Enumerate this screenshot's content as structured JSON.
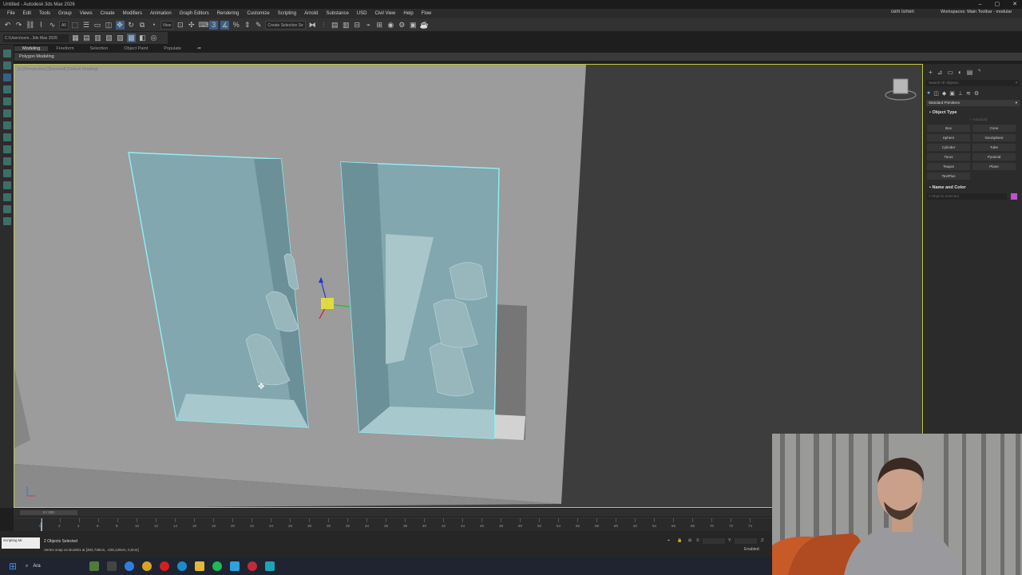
{
  "window": {
    "title": "Untitled - Autodesk 3ds Max 2026",
    "minimize": "–",
    "restore": "▢",
    "close": "✕"
  },
  "menu": {
    "items": [
      "File",
      "Edit",
      "Tools",
      "Group",
      "Views",
      "Create",
      "Modifiers",
      "Animation",
      "Graph Editors",
      "Rendering",
      "Customize",
      "Scripting",
      "Arnold",
      "Substance",
      "USD",
      "Civil View",
      "Help",
      "Flow"
    ],
    "user": "cem ismen",
    "workspace_label": "Workspaces:",
    "workspace_value": "Main Toolbar - modular"
  },
  "toolbar": {
    "filter": "All",
    "view_dropdown": "View",
    "selection_set": "Create Selection Se"
  },
  "toolbar2": {
    "path": "C:\\Users\\cem...3ds Max 2026"
  },
  "ribbon": {
    "tabs": [
      "Modeling",
      "Freeform",
      "Selection",
      "Object Paint",
      "Populate"
    ],
    "active_tab": "Modeling",
    "subpanel": "Polygon Modeling"
  },
  "viewport": {
    "label": "[+] [Perspective] [Standard] [Default Shading]"
  },
  "command_panel": {
    "tab_icons": [
      "+",
      "⊿",
      "▭",
      "◐",
      "▤",
      "⌝"
    ],
    "search_placeholder": "Search All Objects...",
    "search_clear": "✕",
    "category": "Standard Primitives",
    "object_type_header": "Object Type",
    "autogrid": "✓ AutoGrid",
    "primitives": [
      "Box",
      "Cone",
      "Sphere",
      "GeoSphere",
      "Cylinder",
      "Tube",
      "Torus",
      "Pyramid",
      "Teapot",
      "Plane",
      "TextPlus"
    ],
    "name_color_header": "Name and Color",
    "name_field": "2 Objects Selected",
    "swatch_color": "#c050d0"
  },
  "timeline": {
    "slider": "0 / 100",
    "ticks": [
      0,
      2,
      4,
      6,
      8,
      10,
      12,
      14,
      16,
      18,
      20,
      22,
      24,
      26,
      28,
      30,
      32,
      34,
      36,
      38,
      40,
      42,
      44,
      46,
      48,
      50,
      52,
      54,
      56,
      58,
      60,
      62,
      64,
      66,
      68,
      70,
      72,
      74,
      76
    ],
    "current_frame": 0
  },
  "status": {
    "script_label": "Scripting Mi",
    "selection": "2 Objects Selected",
    "prompt": "Vertex snap on Box001 at [302,738cm, -228,128cm, 0,0cm]",
    "x_label": "X:",
    "y_label": "Y:",
    "z_label": "Z:",
    "enabled": "Enabled:"
  },
  "taskbar": {
    "search": "Ara"
  }
}
